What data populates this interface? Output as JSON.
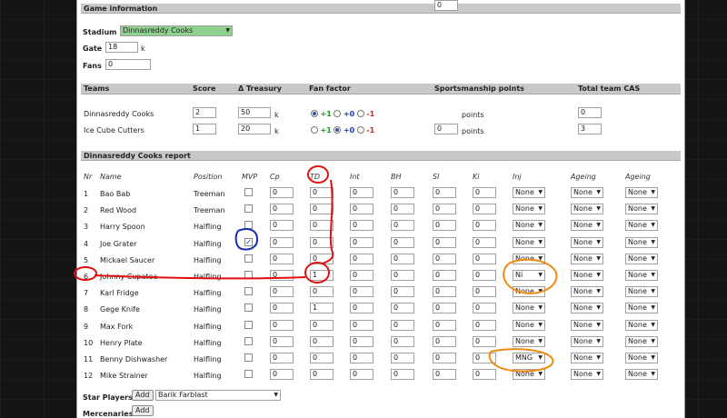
{
  "game_info": {
    "title": "Game information",
    "stadium_label": "Stadium",
    "stadium_value": "Dinnasreddy Cooks",
    "gate_label": "Gate",
    "gate_value": "18",
    "gate_unit": "k",
    "fans_label": "Fans",
    "fans_value": "0"
  },
  "teams_table": {
    "headers": [
      "Teams",
      "Score",
      "Δ Treasury",
      "Fan factor",
      "Sportsmanship points",
      "Total team CAS"
    ],
    "rows": [
      {
        "team": "Dinnasreddy Cooks",
        "score": "2",
        "treasury": "50",
        "treasury_unit": "k",
        "fan_opts": [
          "+1",
          "+0",
          "-1"
        ],
        "fan_selected": 0,
        "sportsmanship": "0",
        "sp_unit": "points",
        "cas": "0"
      },
      {
        "team": "Ice Cube Cutters",
        "score": "1",
        "treasury": "20",
        "treasury_unit": "k",
        "fan_opts": [
          "+1",
          "+0",
          "-1"
        ],
        "fan_selected": 1,
        "sportsmanship": "0",
        "sp_unit": "points",
        "cas": "3"
      }
    ]
  },
  "report": {
    "title": "Dinnasreddy Cooks report",
    "columns": [
      "Nr",
      "Name",
      "Position",
      "MVP",
      "Cp",
      "TD",
      "Int",
      "BH",
      "SI",
      "Ki",
      "Inj",
      "Ageing",
      "Ageing"
    ],
    "players": [
      {
        "nr": "1",
        "name": "Bao Bab",
        "position": "Treeman",
        "mvp": false,
        "cp": "0",
        "td": "0",
        "int": "0",
        "bh": "0",
        "si": "0",
        "ki": "0",
        "inj": "None",
        "age1": "None",
        "age2": "None"
      },
      {
        "nr": "2",
        "name": "Red Wood",
        "position": "Treeman",
        "mvp": false,
        "cp": "0",
        "td": "0",
        "int": "0",
        "bh": "0",
        "si": "0",
        "ki": "0",
        "inj": "None",
        "age1": "None",
        "age2": "None"
      },
      {
        "nr": "3",
        "name": "Harry Spoon",
        "position": "Halfling",
        "mvp": false,
        "cp": "0",
        "td": "0",
        "int": "0",
        "bh": "0",
        "si": "0",
        "ki": "0",
        "inj": "None",
        "age1": "None",
        "age2": "None"
      },
      {
        "nr": "4",
        "name": "Joe Grater",
        "position": "Halfling",
        "mvp": true,
        "cp": "0",
        "td": "0",
        "int": "0",
        "bh": "0",
        "si": "0",
        "ki": "0",
        "inj": "None",
        "age1": "None",
        "age2": "None"
      },
      {
        "nr": "5",
        "name": "Mickael Saucer",
        "position": "Halfling",
        "mvp": false,
        "cp": "0",
        "td": "0",
        "int": "0",
        "bh": "0",
        "si": "0",
        "ki": "0",
        "inj": "None",
        "age1": "None",
        "age2": "None"
      },
      {
        "nr": "6",
        "name": "Johnny Cupatea",
        "position": "Halfling",
        "mvp": false,
        "cp": "0",
        "td": "1",
        "int": "0",
        "bh": "0",
        "si": "0",
        "ki": "0",
        "inj": "Ni",
        "age1": "None",
        "age2": "None"
      },
      {
        "nr": "7",
        "name": "Karl Fridge",
        "position": "Halfling",
        "mvp": false,
        "cp": "0",
        "td": "0",
        "int": "0",
        "bh": "0",
        "si": "0",
        "ki": "0",
        "inj": "None",
        "age1": "None",
        "age2": "None"
      },
      {
        "nr": "8",
        "name": "Gege Knife",
        "position": "Halfling",
        "mvp": false,
        "cp": "0",
        "td": "1",
        "int": "0",
        "bh": "0",
        "si": "0",
        "ki": "0",
        "inj": "None",
        "age1": "None",
        "age2": "None"
      },
      {
        "nr": "9",
        "name": "Max Fork",
        "position": "Halfling",
        "mvp": false,
        "cp": "0",
        "td": "0",
        "int": "0",
        "bh": "0",
        "si": "0",
        "ki": "0",
        "inj": "None",
        "age1": "None",
        "age2": "None"
      },
      {
        "nr": "10",
        "name": "Henry Plate",
        "position": "Halfling",
        "mvp": false,
        "cp": "0",
        "td": "0",
        "int": "0",
        "bh": "0",
        "si": "0",
        "ki": "0",
        "inj": "None",
        "age1": "None",
        "age2": "None"
      },
      {
        "nr": "11",
        "name": "Benny Dishwasher",
        "position": "Halfling",
        "mvp": false,
        "cp": "0",
        "td": "0",
        "int": "0",
        "bh": "0",
        "si": "0",
        "ki": "0",
        "inj": "MNG",
        "age1": "None",
        "age2": "None"
      },
      {
        "nr": "12",
        "name": "Mike Strainer",
        "position": "Halfling",
        "mvp": false,
        "cp": "0",
        "td": "0",
        "int": "0",
        "bh": "0",
        "si": "0",
        "ki": "0",
        "inj": "None",
        "age1": "None",
        "age2": "None"
      }
    ]
  },
  "star_players": {
    "label": "Star Players:",
    "add_label": "Add",
    "selected": "Barik Farblast"
  },
  "mercenaries": {
    "label": "Mercenaries:",
    "add_label": "Add"
  },
  "colors": {
    "annotation_red": "#e01010",
    "annotation_blue": "#1a2ab8",
    "annotation_orange": "#f08a10",
    "checked_mark": "#1a3ab0",
    "stadium_fill": "#8fd18f",
    "header_gray": "#c9c9c9"
  }
}
